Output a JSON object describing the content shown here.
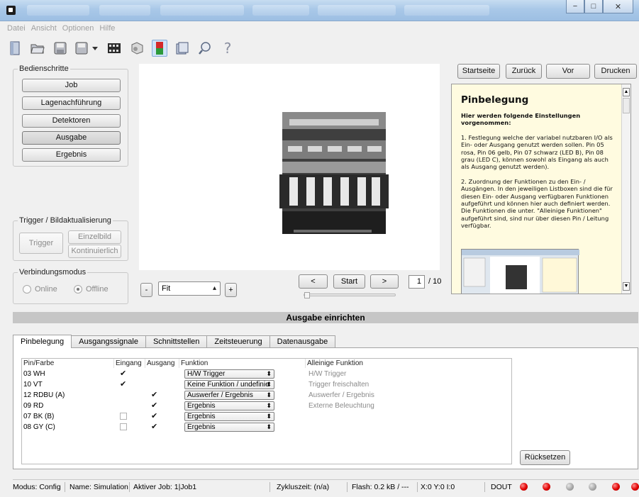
{
  "titlebar": {
    "window_controls": {
      "minimize": "−",
      "maximize": "□",
      "close": "✕"
    }
  },
  "menu": [
    "Datei",
    "Ansicht",
    "Optionen",
    "Hilfe"
  ],
  "toolbar": {
    "icons": [
      "new-doc-icon",
      "open-folder-icon",
      "save-icon",
      "save-as-icon",
      "filmstrip-icon",
      "camera-icon",
      "io-connector-icon",
      "panel-icon",
      "search-icon",
      "help-icon"
    ],
    "help_glyph": "?"
  },
  "bedienschritte": {
    "title": "Bedienschritte",
    "steps": [
      "Job",
      "Lagenachführung",
      "Detektoren",
      "Ausgabe",
      "Ergebnis"
    ],
    "active_step": "Ausgabe"
  },
  "trigger": {
    "title": "Trigger / Bildaktualisierung",
    "trigger_label": "Trigger",
    "einzelbild_label": "Einzelbild",
    "kontinuierlich_label": "Kontinuierlich"
  },
  "connection": {
    "title": "Verbindungsmodus",
    "online_label": "Online",
    "offline_label": "Offline",
    "selected": "Offline"
  },
  "image_controls": {
    "zoom_minus": "-",
    "zoom_value": "Fit",
    "zoom_plus": "+",
    "prev_label": "<",
    "start_label": "Start",
    "next_label": ">",
    "page_current": "1",
    "page_total": "/ 10"
  },
  "help_nav": {
    "startseite": "Startseite",
    "zurueck": "Zurück",
    "vor": "Vor",
    "drucken": "Drucken"
  },
  "help": {
    "title": "Pinbelegung",
    "lead": "Hier werden folgende Einstellungen vorgenommen:",
    "p1": "1. Festlegung welche der variabel nutzbaren I/O als Ein- oder Ausgang genutzt werden sollen. Pin 05 rosa, Pin 06 gelb, Pin 07 schwarz (LED B), Pin 08 grau (LED C), können sowohl als Eingang als auch als Ausgang genutzt werden).",
    "p2": "2. Zuordnung der Funktionen zu den Ein- / Ausgängen. In den jeweiligen Listboxen sind die für diesen Ein- oder Ausgang verfügbaren Funktionen aufgeführt und können hier auch definiert werden. Die Funktionen die unter. \"Alleinige Funktionen\" aufgeführt sind, sind nur über diesen Pin / Leitung verfügbar."
  },
  "section_title": "Ausgabe einrichten",
  "tabs": [
    "Pinbelegung",
    "Ausgangssignale",
    "Schnittstellen",
    "Zeitsteuerung",
    "Datenausgabe"
  ],
  "active_tab": "Pinbelegung",
  "pin_table": {
    "headers": [
      "Pin/Farbe",
      "Eingang",
      "Ausgang",
      "Funktion",
      "Alleinige Funktion"
    ],
    "rows": [
      {
        "pin": "03 WH",
        "eingang": true,
        "ausgang": false,
        "eingang_enabled": true,
        "funktion": "H/W Trigger",
        "alleinige": "H/W Trigger"
      },
      {
        "pin": "10 VT",
        "eingang": true,
        "ausgang": false,
        "eingang_enabled": true,
        "funktion": "Keine Funktion / undefinie",
        "alleinige": "Trigger freischalten"
      },
      {
        "pin": "12 RDBU (A)",
        "eingang": false,
        "ausgang": true,
        "eingang_enabled": true,
        "funktion": "Auswerfer / Ergebnis",
        "alleinige": "Auswerfer / Ergebnis"
      },
      {
        "pin": "09 RD",
        "eingang": false,
        "ausgang": true,
        "eingang_enabled": true,
        "funktion": "Ergebnis",
        "alleinige": "Externe Beleuchtung"
      },
      {
        "pin": "07 BK (B)",
        "eingang": false,
        "ausgang": true,
        "eingang_enabled": false,
        "funktion": "Ergebnis",
        "alleinige": ""
      },
      {
        "pin": "08 GY (C)",
        "eingang": false,
        "ausgang": true,
        "eingang_enabled": false,
        "funktion": "Ergebnis",
        "alleinige": ""
      }
    ]
  },
  "reset_label": "Rücksetzen",
  "status": {
    "modus": "Modus:  Config",
    "name": "Name:  Simulation",
    "job": "Aktiver Job:  1|Job1",
    "zyklus": "Zykluszeit:  (n/a)",
    "flash": "Flash:  0.2 kB / ---",
    "coords": "X:0 Y:0 I:0",
    "dout_label": "DOUT",
    "leds": [
      "red",
      "red",
      "gray",
      "gray",
      "red",
      "red"
    ]
  },
  "colors": {
    "help_bg": "#fffbe0",
    "section_bar": "#c6c6c6",
    "led_red": "#e00000",
    "led_gray": "#a9a9a9"
  }
}
